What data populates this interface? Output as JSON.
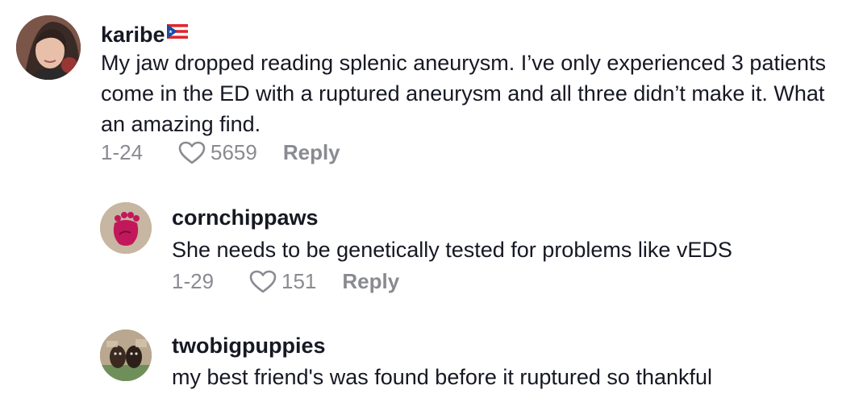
{
  "comments": [
    {
      "username": "karibe",
      "text": "My jaw dropped reading splenic aneurysm. I’ve only experienced 3 patients come in the ED with a ruptured aneurysm and all three didn’t make it. What an amazing find.",
      "date": "1-24",
      "likes": "5659",
      "reply_label": "Reply",
      "flag_icon": "puerto-rico-flag-icon"
    },
    {
      "username": "cornchippaws",
      "text": "She needs to be genetically tested for problems like vEDS",
      "date": "1-29",
      "likes": "151",
      "reply_label": "Reply"
    },
    {
      "username": "twobigpuppies",
      "text": "my best friend's was found before it ruptured so thankful"
    }
  ],
  "colors": {
    "text": "#161823",
    "muted": "#8a8b91",
    "background": "#ffffff"
  }
}
